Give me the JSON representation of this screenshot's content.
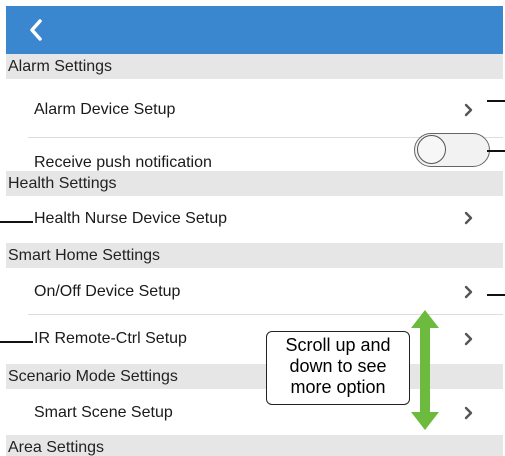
{
  "colors": {
    "appbar": "#3a86cf",
    "section_background": "#e6e6e6",
    "arrow": "#6dbb3e"
  },
  "appbar": {
    "back_icon": "chevron-left-icon"
  },
  "sections": [
    {
      "title": "Alarm Settings",
      "items": [
        {
          "label": "Alarm Device Setup",
          "control": "chevron-right-icon"
        },
        {
          "label": "Receive push notification",
          "control": "toggle",
          "toggle_on": false
        }
      ]
    },
    {
      "title": "Health Settings",
      "items": [
        {
          "label": "Health Nurse Device Setup",
          "control": "chevron-right-icon"
        }
      ]
    },
    {
      "title": "Smart Home Settings",
      "items": [
        {
          "label": "On/Off Device Setup",
          "control": "chevron-right-icon"
        },
        {
          "label": "IR Remote-Ctrl Setup",
          "control": "chevron-right-icon"
        }
      ]
    },
    {
      "title": "Scenario Mode Settings",
      "items": [
        {
          "label": "Smart Scene Setup",
          "control": "chevron-right-icon"
        }
      ]
    },
    {
      "title": "Area Settings",
      "items": []
    }
  ],
  "annotation": {
    "callout_lines": [
      "Scroll up and",
      "down to see",
      "more option"
    ],
    "arrow_icon": "double-headed-arrow-icon"
  }
}
